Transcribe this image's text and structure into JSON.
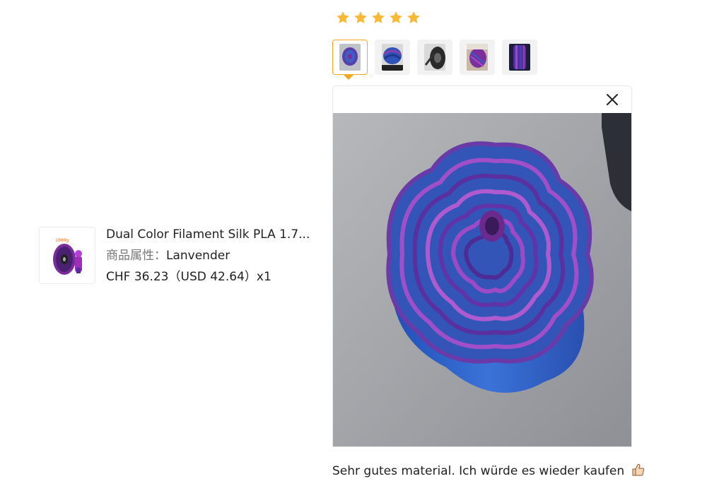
{
  "product": {
    "title": "Dual Color Filament Silk PLA 1.7...",
    "attr_label": "商品属性：",
    "attr_value": "Lanvender",
    "price": "CHF 36.23（USD  42.64）x1",
    "thumb_icon": "filament-spool-image"
  },
  "review": {
    "rating": 5,
    "text": "Sehr gutes material. Ich würde es wieder kaufen",
    "emoji_icon": "thumbs-up-icon",
    "thumbnails": [
      {
        "name": "review-photo-1",
        "active": true
      },
      {
        "name": "review-photo-2",
        "active": false
      },
      {
        "name": "review-photo-3",
        "active": false
      },
      {
        "name": "review-photo-4",
        "active": false
      },
      {
        "name": "review-photo-5",
        "active": false
      }
    ],
    "close_icon": "close-icon"
  },
  "colors": {
    "star": "#f8b936",
    "active_border": "#f5a623",
    "filament_purple": "#8a3fb0",
    "filament_blue": "#3a63c9"
  }
}
